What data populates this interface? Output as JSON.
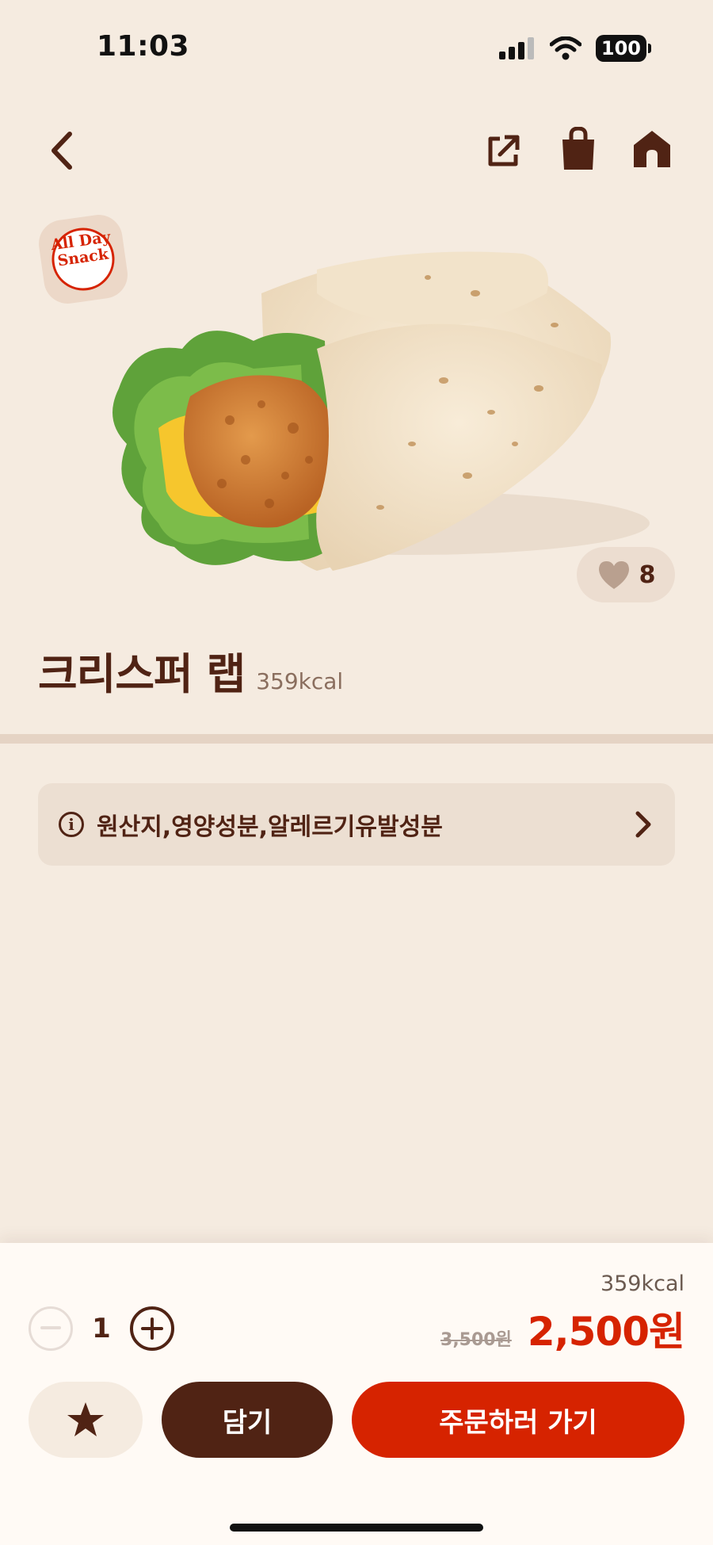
{
  "status_bar": {
    "time": "11:03",
    "battery": "100"
  },
  "nav": {
    "back_icon": "chevron-left-icon",
    "share_icon": "share-icon",
    "bag_icon": "shopping-bag-icon",
    "home_icon": "home-icon"
  },
  "badge": {
    "line1": "All Day",
    "line2": "Snack"
  },
  "like": {
    "count": "8",
    "icon": "heart-icon"
  },
  "product": {
    "name": "크리스퍼 랩",
    "kcal": "359kcal"
  },
  "info_bar": {
    "label": "원산지,영양성분,알레르기유발성분",
    "icon": "info-icon"
  },
  "order": {
    "kcal": "359kcal",
    "quantity": "1",
    "original_price": "3,500원",
    "sale_price": "2,500원",
    "cart_label": "담기",
    "order_label": "주문하러 가기",
    "favorite_icon": "star-icon"
  },
  "colors": {
    "brand_brown": "#502314",
    "brand_red": "#d62300",
    "background": "#f5ebe0"
  }
}
